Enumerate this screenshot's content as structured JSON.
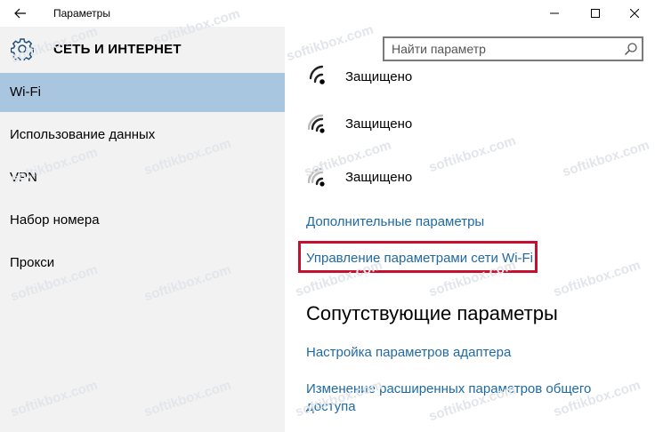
{
  "window": {
    "title": "Параметры"
  },
  "sidebar": {
    "section_title": "СЕТЬ И ИНТЕРНЕТ",
    "items": [
      {
        "label": "Wi-Fi",
        "active": true
      },
      {
        "label": "Использование данных",
        "active": false
      },
      {
        "label": "VPN",
        "active": false
      },
      {
        "label": "Набор номера",
        "active": false
      },
      {
        "label": "Прокси",
        "active": false
      }
    ]
  },
  "search": {
    "placeholder": "Найти параметр"
  },
  "networks": [
    {
      "status": "Защищено"
    },
    {
      "status": "Защищено"
    },
    {
      "status": "Защищено"
    }
  ],
  "links": {
    "advanced": "Дополнительные параметры",
    "manage_wifi": "Управление параметрами сети Wi-Fi"
  },
  "related": {
    "heading": "Сопутствующие параметры",
    "adapter": "Настройка параметров адаптера",
    "sharing": "Изменение расширенных параметров общего доступа"
  },
  "watermark": "softikbox.com",
  "colors": {
    "accent": "#1f6aa5",
    "selected": "#a9c6e0",
    "sidebar_bg": "#f2f2f2",
    "highlight": "#c8102e"
  }
}
